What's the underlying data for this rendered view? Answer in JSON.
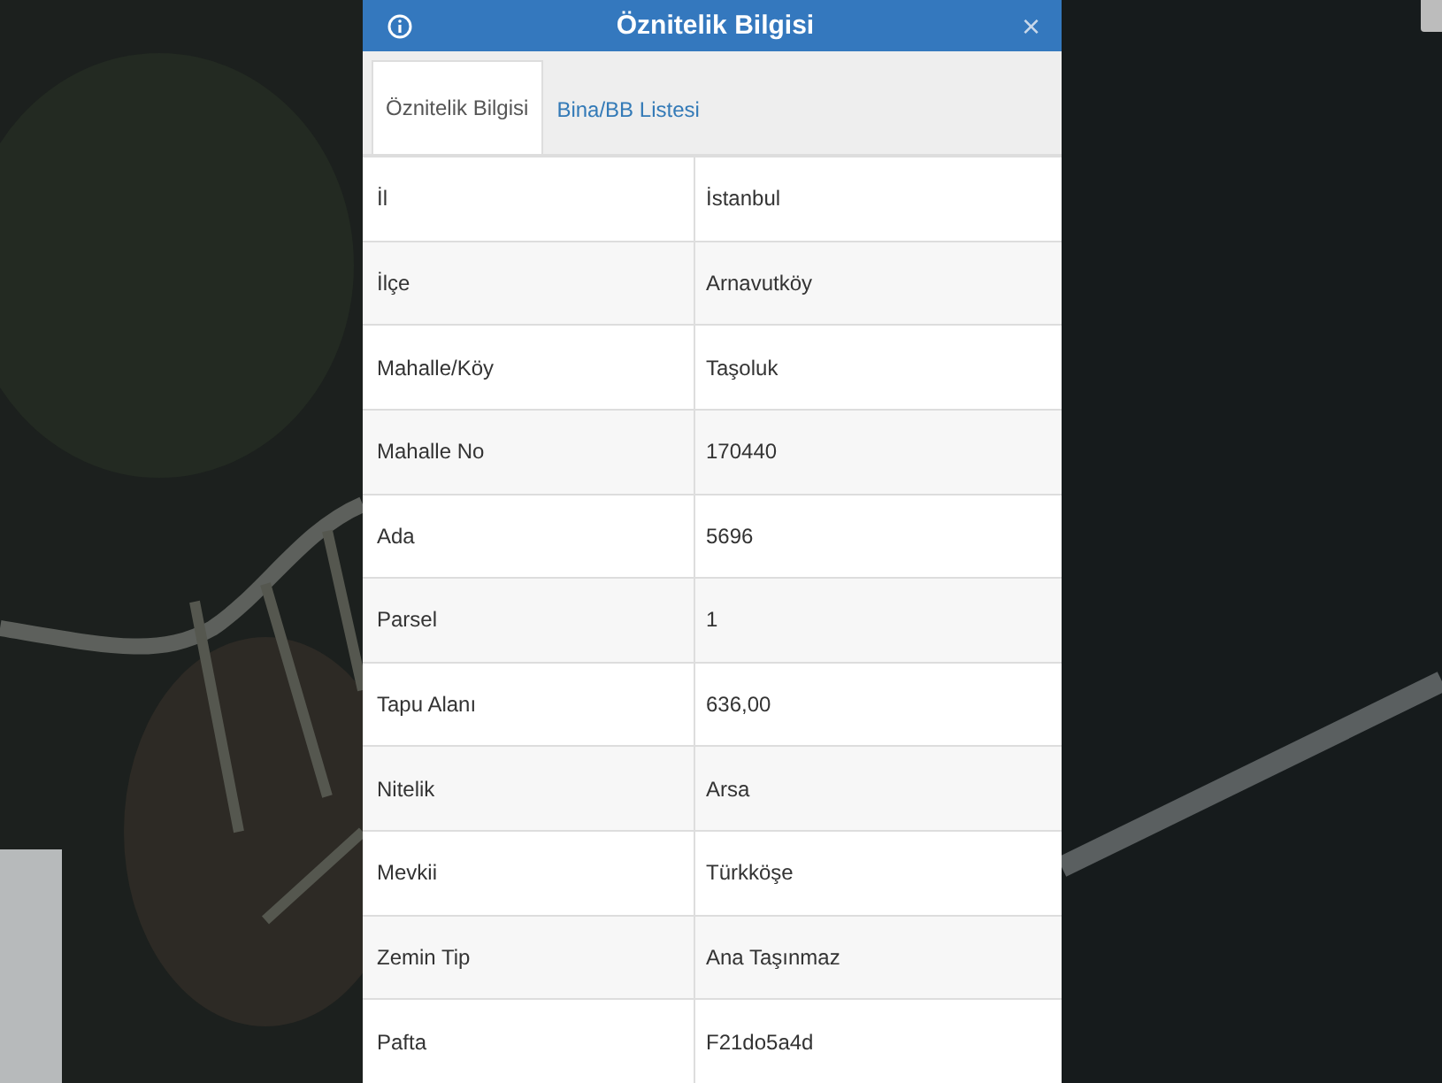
{
  "dialog": {
    "title": "Öznitelik Bilgisi",
    "close_label": "×"
  },
  "tabs": [
    {
      "label": "Öznitelik Bilgisi",
      "selected": true
    },
    {
      "label": "Bina/BB Listesi",
      "selected": false
    }
  ],
  "table": {
    "rows": [
      {
        "label": "İl",
        "value": "İstanbul"
      },
      {
        "label": "İlçe",
        "value": "Arnavutköy"
      },
      {
        "label": "Mahalle/Köy",
        "value": "Taşoluk"
      },
      {
        "label": "Mahalle No",
        "value": "170440"
      },
      {
        "label": "Ada",
        "value": "5696"
      },
      {
        "label": "Parsel",
        "value": "1"
      },
      {
        "label": "Tapu Alanı",
        "value": "636,00"
      },
      {
        "label": "Nitelik",
        "value": "Arsa"
      },
      {
        "label": "Mevkii",
        "value": "Türkköşe"
      },
      {
        "label": "Zemin Tip",
        "value": "Ana Taşınmaz"
      },
      {
        "label": "Pafta",
        "value": "F21do5a4d"
      }
    ]
  }
}
